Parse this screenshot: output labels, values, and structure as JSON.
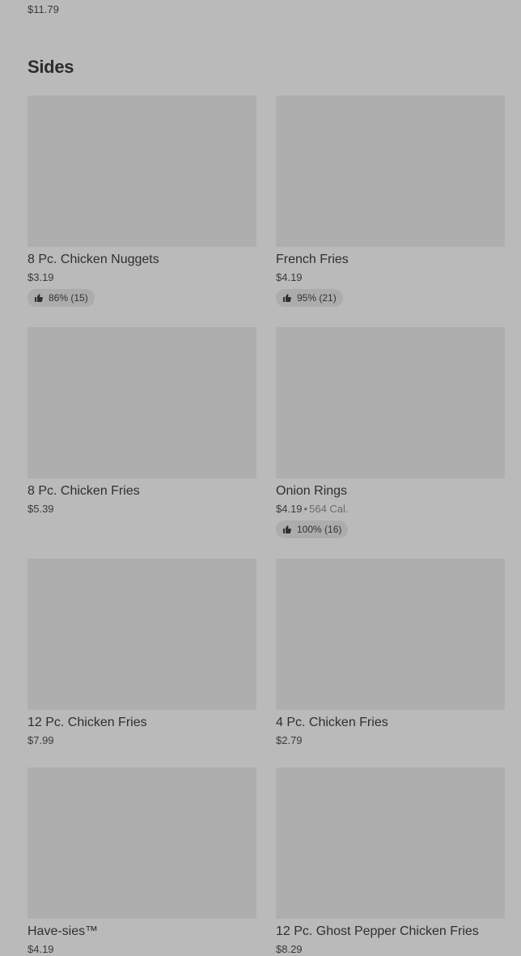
{
  "previous_item": {
    "price": "$11.79"
  },
  "section": {
    "title": "Sides"
  },
  "items": [
    {
      "name": "8 Pc. Chicken Nuggets",
      "price": "$3.19",
      "calories": "",
      "rating": "86% (15)"
    },
    {
      "name": "French Fries",
      "price": "$4.19",
      "calories": "",
      "rating": "95% (21)"
    },
    {
      "name": "8 Pc. Chicken Fries",
      "price": "$5.39",
      "calories": "",
      "rating": ""
    },
    {
      "name": "Onion Rings",
      "price": "$4.19",
      "calories": "564 Cal.",
      "rating": "100% (16)"
    },
    {
      "name": "12 Pc. Chicken Fries",
      "price": "$7.99",
      "calories": "",
      "rating": ""
    },
    {
      "name": "4 Pc. Chicken Fries",
      "price": "$2.79",
      "calories": "",
      "rating": ""
    },
    {
      "name": "Have-sies™",
      "price": "$4.19",
      "calories": "",
      "rating": ""
    },
    {
      "name": "12 Pc. Ghost Pepper Chicken Fries",
      "price": "$8.29",
      "calories": "",
      "rating": ""
    }
  ]
}
